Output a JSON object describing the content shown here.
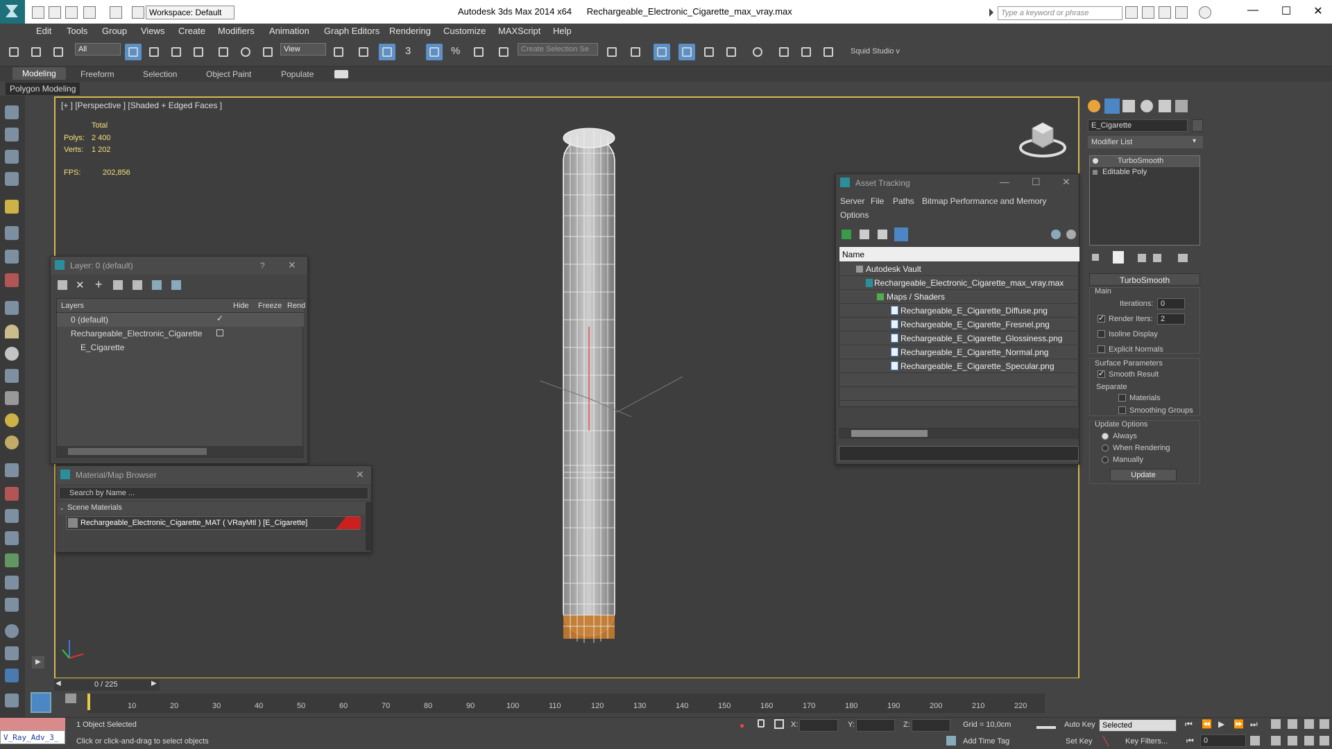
{
  "titlebar": {
    "workspace": "Workspace: Default",
    "app_version": "Autodesk 3ds Max  2014 x64",
    "file_name": "Rechargeable_Electronic_Cigarette_max_vray.max",
    "search_placeholder": "Type a keyword or phrase"
  },
  "menu": [
    "Edit",
    "Tools",
    "Group",
    "Views",
    "Create",
    "Modifiers",
    "Animation",
    "Graph Editors",
    "Rendering",
    "Customize",
    "MAXScript",
    "Help"
  ],
  "toolbar": {
    "filter_value": "All",
    "refcoord_value": "View",
    "selection_set_placeholder": "Create Selection Se",
    "squid_label": "Squid Studio v",
    "snap_label": "3",
    "percent_label": "%"
  },
  "ribbon": {
    "tabs": [
      "Modeling",
      "Freeform",
      "Selection",
      "Object Paint",
      "Populate"
    ],
    "sub_label": "Polygon Modeling"
  },
  "viewport": {
    "label": "[+ ] [Perspective ] [Shaded + Edged Faces ]",
    "stats": {
      "total_label": "Total",
      "polys_label": "Polys:",
      "polys_value": "2 400",
      "verts_label": "Verts:",
      "verts_value": "1 202",
      "fps_label": "FPS:",
      "fps_value": "202,856"
    }
  },
  "layer_window": {
    "title": "Layer: 0 (default)",
    "help": "?",
    "columns": [
      "Layers",
      "Hide",
      "Freeze",
      "Rend"
    ],
    "rows": [
      {
        "name": "0 (default)"
      },
      {
        "name": "Rechargeable_Electronic_Cigarette"
      },
      {
        "name": "E_Cigarette"
      }
    ]
  },
  "material_browser": {
    "title": "Material/Map Browser",
    "search_placeholder": "Search by Name ...",
    "group": "Scene Materials",
    "item": "Rechargeable_Electronic_Cigarette_MAT  ( VRayMtl )  [E_Cigarette]",
    "group_toggle": "-"
  },
  "asset_tracking": {
    "title": "Asset Tracking",
    "menu": [
      "Server",
      "File",
      "Paths",
      "Bitmap Performance and Memory",
      "Options"
    ],
    "column": "Name",
    "rows": [
      {
        "label": "Autodesk Vault"
      },
      {
        "label": "Rechargeable_Electronic_Cigarette_max_vray.max"
      },
      {
        "label": "Maps / Shaders"
      },
      {
        "label": "Rechargeable_E_Cigarette_Diffuse.png"
      },
      {
        "label": "Rechargeable_E_Cigarette_Fresnel.png"
      },
      {
        "label": "Rechargeable_E_Cigarette_Glossiness.png"
      },
      {
        "label": "Rechargeable_E_Cigarette_Normal.png"
      },
      {
        "label": "Rechargeable_E_Cigarette_Specular.png"
      }
    ]
  },
  "command_panel": {
    "object_name": "E_Cigarette",
    "modifier_list": "Modifier List",
    "stack": [
      "TurboSmooth",
      "Editable Poly"
    ],
    "rollout": "TurboSmooth",
    "main_label": "Main",
    "iterations_label": "Iterations:",
    "iterations_value": "0",
    "render_iters_label": "Render Iters:",
    "render_iters_value": "2",
    "isoline_label": "Isoline Display",
    "explicit_normals_label": "Explicit Normals",
    "surface_params_label": "Surface Parameters",
    "smooth_result_label": "Smooth Result",
    "separate_label": "Separate",
    "materials_label": "Materials",
    "smoothing_groups_label": "Smoothing Groups",
    "update_options_label": "Update Options",
    "always_label": "Always",
    "when_rendering_label": "When Rendering",
    "manually_label": "Manually",
    "update_button": "Update"
  },
  "timeline": {
    "frame_display": "0 / 225",
    "ticks": [
      "10",
      "20",
      "30",
      "40",
      "50",
      "60",
      "70",
      "80",
      "90",
      "100",
      "110",
      "120",
      "130",
      "140",
      "150",
      "160",
      "170",
      "180",
      "190",
      "200",
      "210",
      "220"
    ]
  },
  "statusbar": {
    "script_label": "V_Ray_Adv_3_",
    "selection_status": "1 Object Selected",
    "prompt": "Click or click-and-drag to select objects",
    "x_label": "X:",
    "y_label": "Y:",
    "z_label": "Z:",
    "grid": "Grid = 10,0cm",
    "add_time_tag": "Add Time Tag",
    "auto_key": "Auto Key",
    "set_key": "Set Key",
    "key_mode_value": "Selected",
    "key_filters": "Key Filters...",
    "frame_value": "0"
  },
  "colors": {
    "viewport_border": "#d7b94d",
    "stats_text": "#f3e27c",
    "active_button": "#5a91c8",
    "material_swatch": "#cc1f1f",
    "tip_color": "#c77b2c"
  }
}
